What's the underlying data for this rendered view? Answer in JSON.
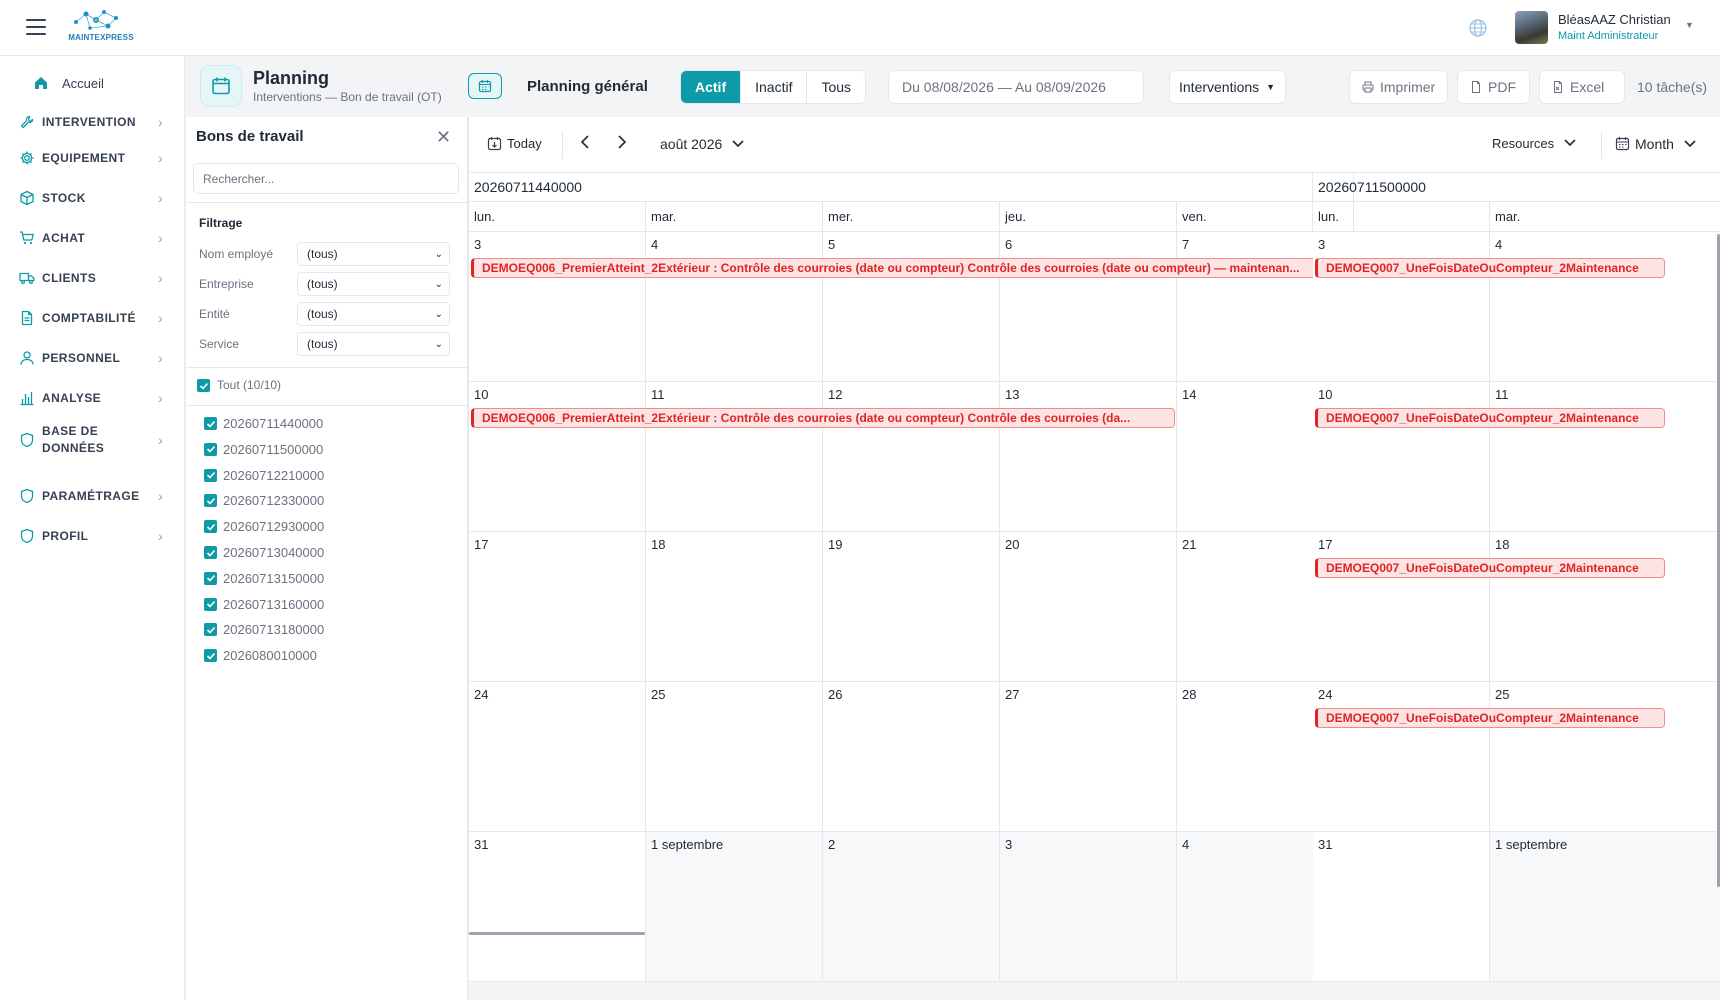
{
  "header": {
    "logo_text": "MAINTEXPRESS",
    "user_name": "BléasAAZ Christian",
    "user_role": "Maint Administrateur"
  },
  "sidebar": {
    "home": "Accueil",
    "items": [
      {
        "label": "INTERVENTION",
        "icon": "wrench-icon"
      },
      {
        "label": "EQUIPEMENT",
        "icon": "gear-icon"
      },
      {
        "label": "STOCK",
        "icon": "box-icon"
      },
      {
        "label": "ACHAT",
        "icon": "cart-icon"
      },
      {
        "label": "CLIENTS",
        "icon": "truck-icon"
      },
      {
        "label": "COMPTABILITÉ",
        "icon": "document-icon"
      },
      {
        "label": "PERSONNEL",
        "icon": "user-icon"
      },
      {
        "label": "ANALYSE",
        "icon": "bar-chart-icon"
      },
      {
        "label": "BASE DE DONNÉES",
        "icon": "shield-icon"
      },
      {
        "label": "PARAMÉTRAGE",
        "icon": "shield-icon"
      },
      {
        "label": "PROFIL",
        "icon": "shield-icon"
      }
    ]
  },
  "page": {
    "title": "Planning",
    "subtitle": "Interventions — Bon de travail (OT)",
    "planning_label": "Planning général",
    "status_tabs": [
      "Actif",
      "Inactif",
      "Tous"
    ],
    "date_range": "Du 08/08/2026 — Au 08/09/2026",
    "type_select": "Interventions",
    "actions": {
      "print": "Imprimer",
      "pdf": "PDF",
      "excel": "Excel"
    },
    "task_count": "10 tâche(s)"
  },
  "panel": {
    "title": "Bons de travail",
    "search_placeholder": "Rechercher...",
    "filter_title": "Filtrage",
    "filters": [
      {
        "label": "Nom employé",
        "value": "(tous)"
      },
      {
        "label": "Entreprise",
        "value": "(tous)"
      },
      {
        "label": "Entité",
        "value": "(tous)"
      },
      {
        "label": "Service",
        "value": "(tous)"
      }
    ],
    "select_all": "Tout (10/10)",
    "orders": [
      "20260711440000",
      "20260711500000",
      "20260712210000",
      "20260712330000",
      "20260712930000",
      "20260713040000",
      "20260713150000",
      "20260713160000",
      "20260713180000",
      "2026080010000"
    ]
  },
  "calendar": {
    "today": "Today",
    "month_label": "août 2026",
    "resources": "Resources",
    "view": "Month",
    "resources_list": [
      {
        "name": "20260711440000",
        "dows": [
          "lun.",
          "mar.",
          "mer.",
          "jeu.",
          "ven."
        ],
        "weeks": [
          [
            "3",
            "4",
            "5",
            "6",
            "7"
          ],
          [
            "10",
            "11",
            "12",
            "13",
            "14"
          ],
          [
            "17",
            "18",
            "19",
            "20",
            "21"
          ],
          [
            "24",
            "25",
            "26",
            "27",
            "28"
          ],
          [
            "31",
            "1 septembre",
            "2",
            "3",
            "4"
          ]
        ],
        "events": [
          {
            "week": 0,
            "start": 0,
            "span": 5,
            "title": "DEMOEQ006_PremierAtteint_2Extérieur : Contrôle des courroies (date ou compteur) Contrôle des courroies (date ou compteur) — maintenan..."
          },
          {
            "week": 1,
            "start": 0,
            "span": 4,
            "title": "DEMOEQ006_PremierAtteint_2Extérieur : Contrôle des courroies (date ou compteur) Contrôle des courroies (da..."
          }
        ]
      },
      {
        "name": "20260711500000",
        "dows": [
          "lun.",
          "mar."
        ],
        "weeks": [
          [
            "3",
            "4"
          ],
          [
            "10",
            "11"
          ],
          [
            "17",
            "18"
          ],
          [
            "24",
            "25"
          ],
          [
            "31",
            "1 septembre"
          ]
        ],
        "events": [
          {
            "week": 0,
            "start": 0,
            "span": 2,
            "title": "DEMOEQ007_UneFoisDateOuCompteur_2Maintenance"
          },
          {
            "week": 1,
            "start": 0,
            "span": 2,
            "title": "DEMOEQ007_UneFoisDateOuCompteur_2Maintenance"
          },
          {
            "week": 2,
            "start": 0,
            "span": 2,
            "title": "DEMOEQ007_UneFoisDateOuCompteur_2Maintenance"
          },
          {
            "week": 3,
            "start": 0,
            "span": 2,
            "title": "DEMOEQ007_UneFoisDateOuCompteur_2Maintenance"
          }
        ]
      }
    ]
  },
  "colors": {
    "accent": "#0e9aa7",
    "event": "#e02424",
    "event_bg": "#fde4e4"
  }
}
